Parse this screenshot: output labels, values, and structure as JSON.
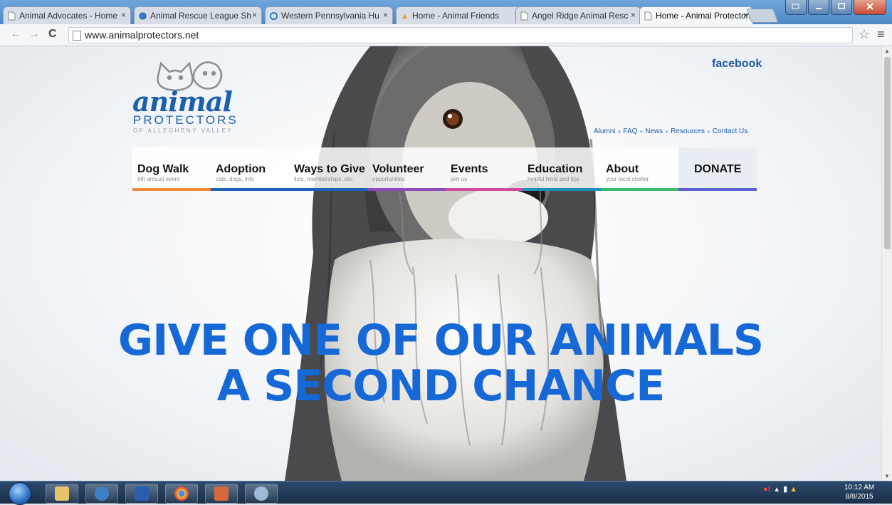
{
  "browser": {
    "tabs": [
      {
        "title": "Animal Advocates - Home"
      },
      {
        "title": "Animal Rescue League Sh"
      },
      {
        "title": "Western Pennsylvania Hu"
      },
      {
        "title": "Home - Animal Friends"
      },
      {
        "title": "Angel Ridge Animal Resc"
      },
      {
        "title": "Home - Animal Protectors"
      }
    ],
    "close_glyph": "×",
    "url": "www.animalprotectors.net"
  },
  "site": {
    "logo": {
      "script": "animal",
      "word": "PROTECTORS",
      "sub": "OF ALLEGHENY VALLEY"
    },
    "facebook_label": "facebook",
    "top_links": [
      "Alumni",
      "FAQ",
      "News",
      "Resources",
      "Contact Us"
    ],
    "nav": [
      {
        "label": "Dog Walk",
        "sub": "6th annual event",
        "color": "#f08a3c"
      },
      {
        "label": "Adoption",
        "sub": "cats, dogs, info",
        "color": "#1c62b8"
      },
      {
        "label": "Ways to Give",
        "sub": "lists, memberships, etc.",
        "color": "#1c62b8"
      },
      {
        "label": "Volunteer",
        "sub": "opportunities",
        "color": "#8a4bbf"
      },
      {
        "label": "Events",
        "sub": "join us",
        "color": "#d04aa0"
      },
      {
        "label": "Education",
        "sub": "helpful hints and tips",
        "color": "#1e8fb5"
      },
      {
        "label": "About",
        "sub": "your local shelter",
        "color": "#3fb86a"
      }
    ],
    "donate_label": "DONATE",
    "headline_line1": "GIVE ONE OF OUR ANIMALS",
    "headline_line2": "A SECOND CHANCE"
  },
  "taskbar": {
    "time": "10:12 AM",
    "date": "8/8/2015"
  }
}
